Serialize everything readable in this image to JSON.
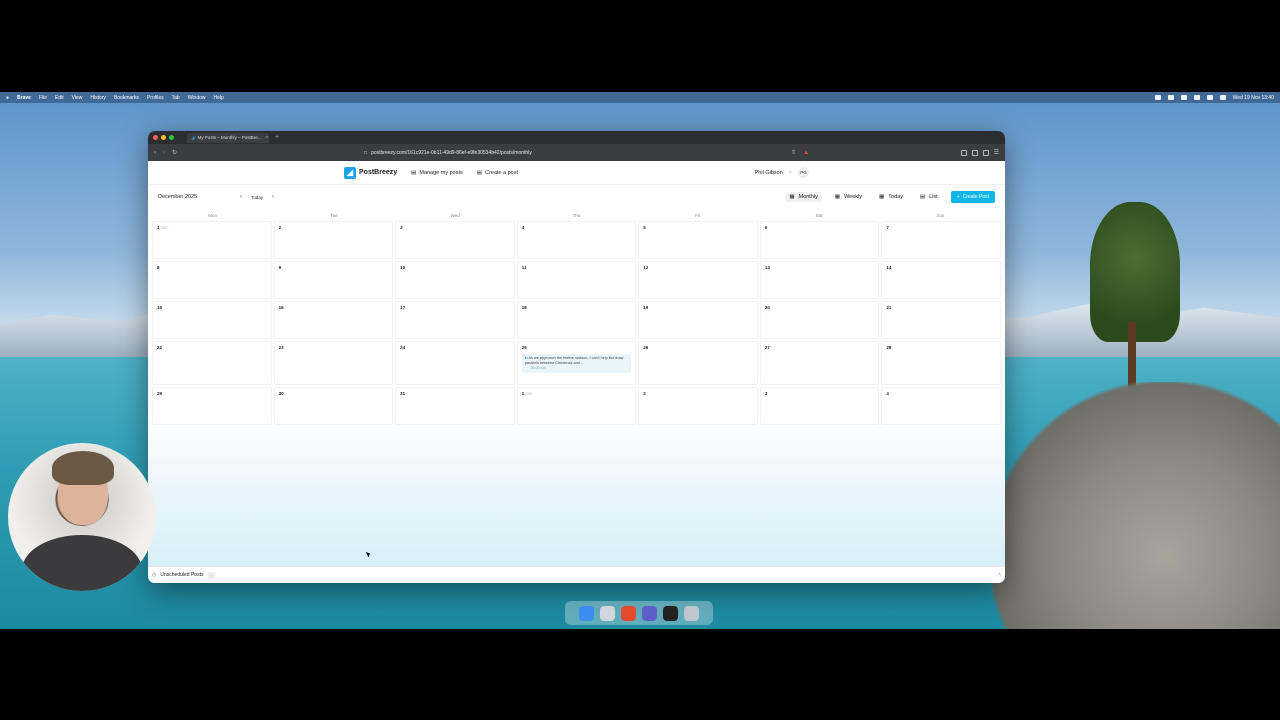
{
  "menubar": {
    "items": [
      "Brave",
      "File",
      "Edit",
      "View",
      "History",
      "Bookmarks",
      "Profiles",
      "Tab",
      "Window",
      "Help"
    ],
    "clock": "Wed 19 Nov 13:40"
  },
  "browser": {
    "tab_title": "My Posts – Monthly – PostBre…",
    "url": "postbreezy.com/161c921e-0b11-49d9-86ef-e9fe30534b42/posts/monthly"
  },
  "app": {
    "brand": "PostBreezy",
    "nav": [
      "Manage my posts",
      "Create a post"
    ],
    "user_name": "Phil Gibson",
    "user_initials": "PG"
  },
  "toolbar": {
    "month_label": "December 2025",
    "today_label": "Today",
    "views": [
      "Monthly",
      "Weekly",
      "Today",
      "List"
    ],
    "active_view": "Monthly",
    "create_label": "Create Post",
    "accent_color": "#12b5e8"
  },
  "calendar": {
    "weekdays": [
      "Mon",
      "Tue",
      "Wed",
      "Thu",
      "Fri",
      "Sat",
      "Sun"
    ],
    "weeks": [
      [
        {
          "day": "1",
          "sub": "Dec"
        },
        {
          "day": "2"
        },
        {
          "day": "3"
        },
        {
          "day": "4"
        },
        {
          "day": "5"
        },
        {
          "day": "6"
        },
        {
          "day": "7"
        }
      ],
      [
        {
          "day": "8"
        },
        {
          "day": "9"
        },
        {
          "day": "10"
        },
        {
          "day": "11"
        },
        {
          "day": "12"
        },
        {
          "day": "13"
        },
        {
          "day": "14"
        }
      ],
      [
        {
          "day": "15"
        },
        {
          "day": "16"
        },
        {
          "day": "17"
        },
        {
          "day": "18"
        },
        {
          "day": "19"
        },
        {
          "day": "20"
        },
        {
          "day": "21"
        }
      ],
      [
        {
          "day": "22"
        },
        {
          "day": "23"
        },
        {
          "day": "24"
        },
        {
          "day": "25",
          "post": {
            "text": "As we approach the festive season, I can't help but draw parallels between Christmas and...",
            "time": "09:00 AM"
          }
        },
        {
          "day": "26"
        },
        {
          "day": "27"
        },
        {
          "day": "28"
        }
      ],
      [
        {
          "day": "29"
        },
        {
          "day": "30"
        },
        {
          "day": "31"
        },
        {
          "day": "1",
          "sub": "Jan"
        },
        {
          "day": "2"
        },
        {
          "day": "3"
        },
        {
          "day": "4"
        }
      ]
    ]
  },
  "footer": {
    "unscheduled_label": "Unscheduled Posts",
    "unscheduled_count": "0"
  }
}
